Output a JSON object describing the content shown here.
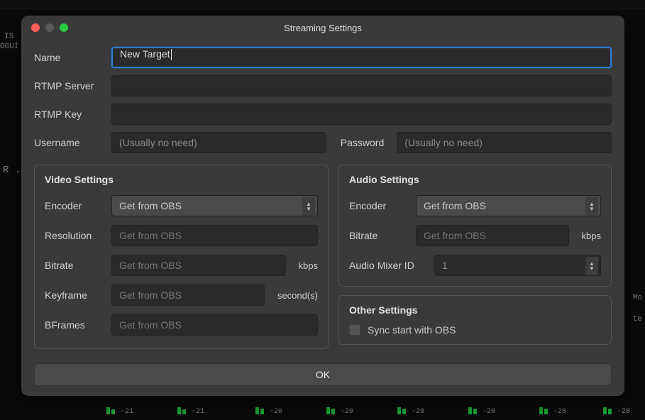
{
  "dialog": {
    "title": "Streaming Settings",
    "name_label": "Name",
    "name_value": "New Target",
    "rtmp_server_label": "RTMP Server",
    "rtmp_server_value": "",
    "rtmp_key_label": "RTMP Key",
    "rtmp_key_value": "",
    "username_label": "Username",
    "username_placeholder": "(Usually no need)",
    "password_label": "Password",
    "password_placeholder": "(Usually no need)",
    "ok_label": "OK"
  },
  "video": {
    "title": "Video Settings",
    "encoder_label": "Encoder",
    "encoder_value": "Get from OBS",
    "resolution_label": "Resolution",
    "resolution_placeholder": "Get from OBS",
    "bitrate_label": "Bitrate",
    "bitrate_placeholder": "Get from OBS",
    "bitrate_unit": "kbps",
    "keyframe_label": "Keyframe",
    "keyframe_placeholder": "Get from OBS",
    "keyframe_unit": "second(s)",
    "bframes_label": "BFrames",
    "bframes_placeholder": "Get from OBS"
  },
  "audio": {
    "title": "Audio Settings",
    "encoder_label": "Encoder",
    "encoder_value": "Get from OBS",
    "bitrate_label": "Bitrate",
    "bitrate_placeholder": "Get from OBS",
    "bitrate_unit": "kbps",
    "mixer_label": "Audio Mixer ID",
    "mixer_value": "1"
  },
  "other": {
    "title": "Other Settings",
    "sync_label": "Sync start with OBS",
    "sync_checked": false
  },
  "background": {
    "left_text_1": "IS",
    "left_text_2": "OGUI",
    "left_text_3": "R .",
    "right_text_1": "Mo",
    "right_text_2": "te",
    "meters": [
      "-21",
      "-21",
      "-20",
      "-20",
      "-20",
      "-20",
      "-20",
      "-20"
    ]
  }
}
